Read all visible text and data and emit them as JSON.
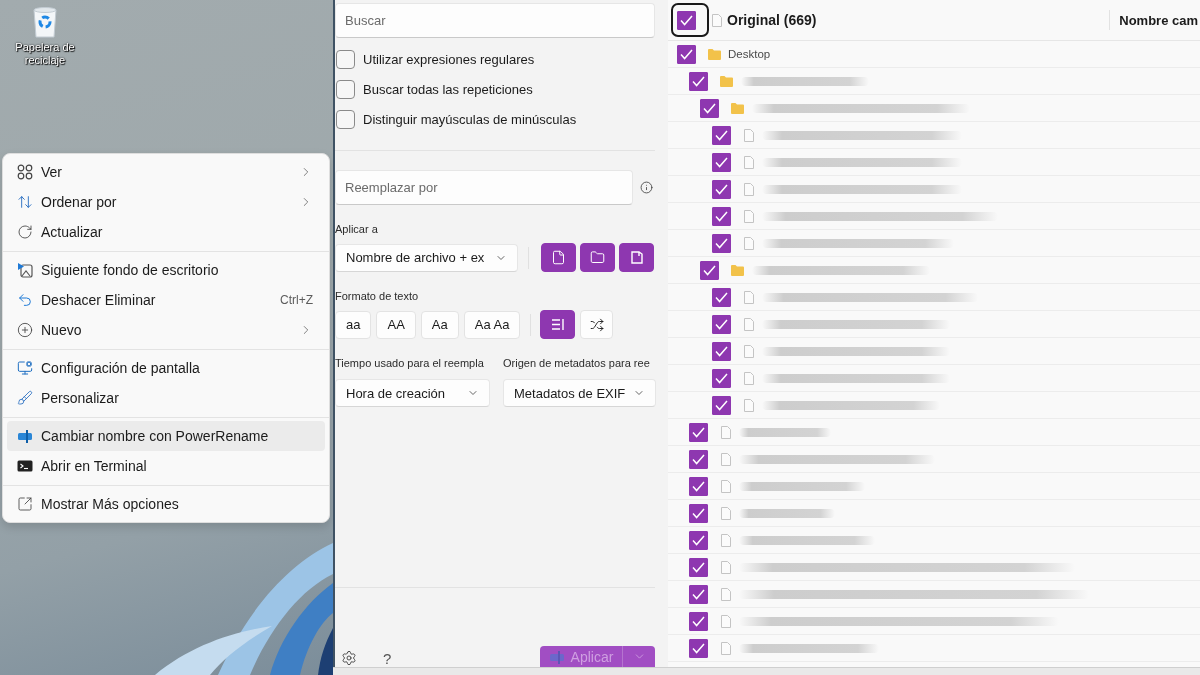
{
  "desktop": {
    "icons": [
      {
        "label": "Papelera de reciclaje"
      }
    ]
  },
  "context_menu": {
    "sections": [
      [
        {
          "label": "Ver",
          "submenu": true,
          "highlighted": false
        },
        {
          "label": "Ordenar por",
          "submenu": true,
          "highlighted": false
        },
        {
          "label": "Actualizar",
          "submenu": false,
          "highlighted": false
        }
      ],
      [
        {
          "label": "Siguiente fondo de escritorio",
          "submenu": false,
          "highlighted": false
        },
        {
          "label": "Deshacer Eliminar",
          "shortcut": "Ctrl+Z",
          "submenu": false,
          "highlighted": false
        },
        {
          "label": "Nuevo",
          "submenu": true,
          "highlighted": false
        }
      ],
      [
        {
          "label": "Configuración de pantalla",
          "submenu": false,
          "highlighted": false
        },
        {
          "label": "Personalizar",
          "submenu": false,
          "highlighted": false
        }
      ],
      [
        {
          "label": "Cambiar nombre con PowerRename",
          "submenu": false,
          "highlighted": true
        },
        {
          "label": "Abrir en Terminal",
          "submenu": false,
          "highlighted": false
        }
      ],
      [
        {
          "label": "Mostrar Más opciones",
          "submenu": false,
          "highlighted": false
        }
      ]
    ]
  },
  "search": {
    "placeholder": "Buscar"
  },
  "options": [
    {
      "label": "Utilizar expresiones regulares",
      "checked": false
    },
    {
      "label": "Buscar todas las repeticiones",
      "checked": false
    },
    {
      "label": "Distinguir mayúsculas de minúsculas",
      "checked": false
    }
  ],
  "replace": {
    "placeholder": "Reemplazar por"
  },
  "apply_to": {
    "label": "Aplicar a",
    "value": "Nombre de archivo + ex",
    "targets": [
      {
        "kind": "files",
        "selected": true
      },
      {
        "kind": "folders",
        "selected": true
      },
      {
        "kind": "subfolders",
        "selected": true
      }
    ]
  },
  "text_format": {
    "label": "Formato de texto",
    "cases": [
      {
        "label": "aa",
        "selected": false
      },
      {
        "label": "AA",
        "selected": false
      },
      {
        "label": "Aa",
        "selected": false
      },
      {
        "label": "Aa Aa",
        "selected": false
      }
    ],
    "modes": [
      {
        "kind": "enumerate",
        "selected": true
      },
      {
        "kind": "randomize",
        "selected": false
      }
    ]
  },
  "time_used": {
    "label": "Tiempo usado para el reempla",
    "value": "Hora de creación"
  },
  "metadata_source": {
    "label": "Origen de metadatos para ree",
    "value": "Metadatos de EXIF"
  },
  "footer": {
    "help": "?",
    "apply": {
      "label": "Aplicar",
      "disabled": true
    }
  },
  "file_list": {
    "original": {
      "label": "Original (669)",
      "checked": true,
      "focused": true
    },
    "column_2": {
      "label": "Nombre cam"
    },
    "items": [
      {
        "kind": "folder",
        "name": "Desktop",
        "blurred": false,
        "checked": true,
        "children": [
          {
            "kind": "folder",
            "blurred": true,
            "checked": true,
            "children": [
              {
                "kind": "folder",
                "blurred": true,
                "checked": true,
                "children": [
                  {
                    "kind": "file",
                    "blurred": true,
                    "checked": true
                  },
                  {
                    "kind": "file",
                    "blurred": true,
                    "checked": true
                  },
                  {
                    "kind": "file",
                    "blurred": true,
                    "checked": true
                  },
                  {
                    "kind": "file",
                    "blurred": true,
                    "checked": true
                  },
                  {
                    "kind": "file",
                    "blurred": true,
                    "checked": true
                  }
                ]
              },
              {
                "kind": "folder",
                "blurred": true,
                "checked": true,
                "children": [
                  {
                    "kind": "file",
                    "blurred": true,
                    "checked": true
                  },
                  {
                    "kind": "file",
                    "blurred": true,
                    "checked": true
                  },
                  {
                    "kind": "file",
                    "blurred": true,
                    "checked": true
                  },
                  {
                    "kind": "file",
                    "blurred": true,
                    "checked": true
                  },
                  {
                    "kind": "file",
                    "blurred": true,
                    "checked": true
                  }
                ]
              }
            ]
          },
          {
            "kind": "file",
            "blurred": true,
            "checked": true
          },
          {
            "kind": "file",
            "blurred": true,
            "checked": true
          },
          {
            "kind": "file",
            "blurred": true,
            "checked": true
          },
          {
            "kind": "file",
            "blurred": true,
            "checked": true
          },
          {
            "kind": "file",
            "blurred": true,
            "checked": true
          },
          {
            "kind": "file",
            "blurred": true,
            "checked": true
          },
          {
            "kind": "file",
            "blurred": true,
            "checked": true
          },
          {
            "kind": "file",
            "blurred": true,
            "checked": true
          },
          {
            "kind": "file",
            "blurred": true,
            "checked": true
          }
        ]
      }
    ]
  }
}
